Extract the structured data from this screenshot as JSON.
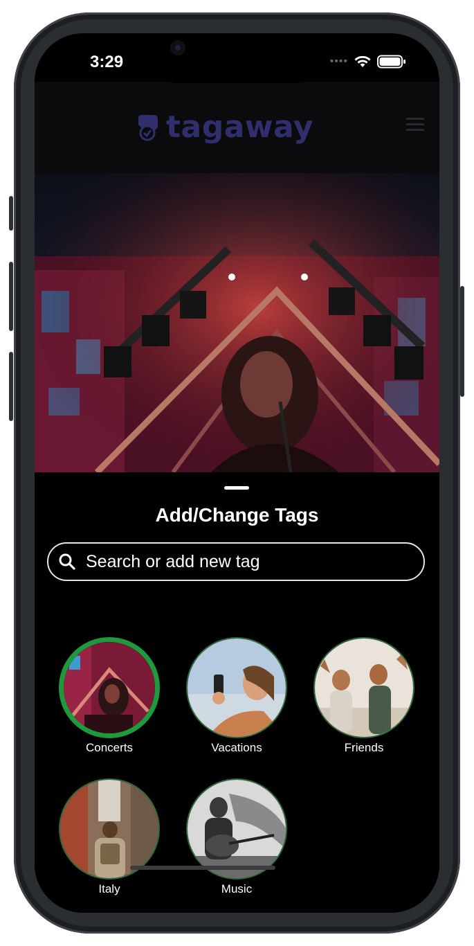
{
  "status_bar": {
    "time": "3:29"
  },
  "header": {
    "app_name": "tagaway",
    "brand_color": "#2f2f6e"
  },
  "sheet": {
    "title": "Add/Change Tags",
    "search_placeholder": "Search or add new tag",
    "tags": [
      {
        "label": "Concerts",
        "selected": true
      },
      {
        "label": "Vacations",
        "selected": false
      },
      {
        "label": "Friends",
        "selected": false
      },
      {
        "label": "Italy",
        "selected": false
      },
      {
        "label": "Music",
        "selected": false
      }
    ]
  },
  "colors": {
    "selected_ring": "#1c9a3c",
    "ring": "#2f6b3a"
  }
}
